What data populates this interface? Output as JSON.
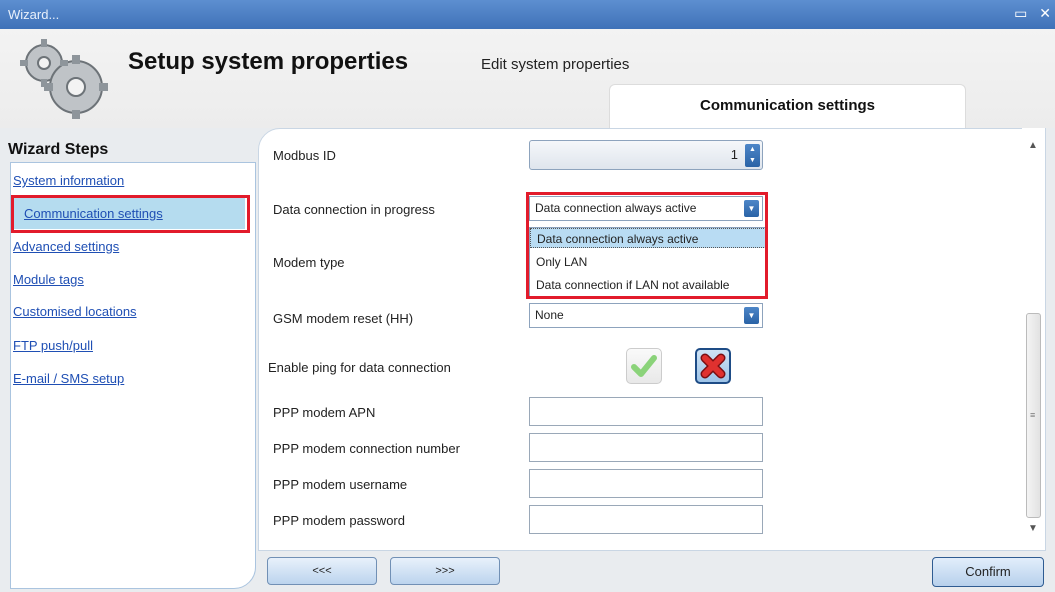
{
  "window": {
    "title": "Wizard...",
    "controls": "▭ ✕"
  },
  "header": {
    "title": "Setup system properties",
    "subtitle": "Edit system properties",
    "current_step": "Communication settings"
  },
  "sidebar": {
    "heading": "Wizard Steps",
    "items": [
      {
        "label": "System information"
      },
      {
        "label": "Communication settings",
        "active": true
      },
      {
        "label": "Advanced settings"
      },
      {
        "label": "Module tags"
      },
      {
        "label": "Customised locations"
      },
      {
        "label": "FTP push/pull"
      },
      {
        "label": "E-mail / SMS setup"
      }
    ]
  },
  "form": {
    "modbus_id": {
      "label": "Modbus ID",
      "value": "1"
    },
    "data_connection": {
      "label": "Data connection in progress",
      "value": "Data connection always active",
      "options": [
        "Data connection always active",
        "Only LAN",
        "Data connection if LAN not available"
      ]
    },
    "modem_type": {
      "label": "Modem type"
    },
    "gsm_reset": {
      "label": "GSM modem reset (HH)",
      "value": "None"
    },
    "ping": {
      "label": "Enable ping for data connection"
    },
    "apn": {
      "label": "PPP modem APN",
      "value": ""
    },
    "conn_number": {
      "label": "PPP modem connection number",
      "value": ""
    },
    "username": {
      "label": "PPP modem username",
      "value": ""
    },
    "password": {
      "label": "PPP modem password",
      "value": ""
    }
  },
  "footer": {
    "prev": "<<<",
    "next": ">>>",
    "confirm": "Confirm"
  },
  "colors": {
    "highlight": "#e21b2b",
    "accent": "#2a63a6",
    "link": "#1f4fb4"
  }
}
